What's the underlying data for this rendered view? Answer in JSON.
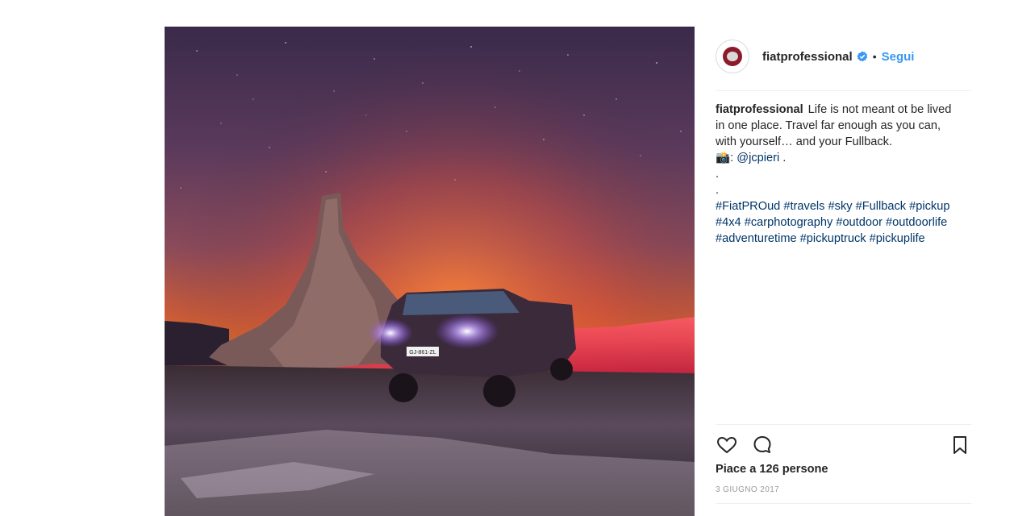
{
  "post": {
    "username": "fiatprofessional",
    "follow_label": "Segui",
    "separator": "•",
    "caption_username": "fiatprofessional",
    "caption_lines": [
      "Life is not meant ot be lived",
      "in one place. Travel far enough as you can,",
      "with yourself… and your Fullback."
    ],
    "photo_credit_prefix": "📸:",
    "photo_credit_handle": "@jcpieri",
    "photo_credit_suffix": " .",
    "dot_line_1": ".",
    "dot_line_2": ".",
    "hashtags_line_1": [
      "#FiatPROud",
      "#travels",
      "#sky",
      "#Fullback",
      "#pickup"
    ],
    "hashtags_line_2": [
      "#4x4",
      "#carphotography",
      "#outdoor",
      "#outdoorlife"
    ],
    "hashtags_line_3": [
      "#adventuretime",
      "#pickuptruck",
      "#pickuplife"
    ],
    "likes_text": "Piace a 126 persone",
    "date": "3 GIUGNO 2017",
    "plate_text": "GJ-861-ZL"
  },
  "icons": {
    "like": "heart-icon",
    "comment": "comment-icon",
    "save": "bookmark-icon",
    "verified": "verified-badge-icon"
  },
  "colors": {
    "link": "#003569",
    "follow": "#3897f0",
    "verified": "#3897f0"
  }
}
